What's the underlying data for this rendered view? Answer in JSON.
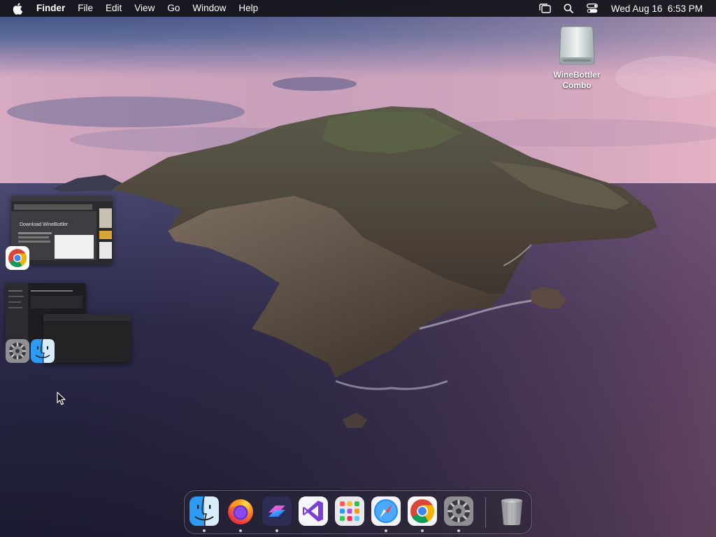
{
  "menubar": {
    "apple_icon": "apple-logo-icon",
    "app_name": "Finder",
    "menus": [
      "File",
      "Edit",
      "View",
      "Go",
      "Window"
    ],
    "help": "Help",
    "status_icons": [
      "stage-manager-icon",
      "spotlight-search-icon",
      "control-center-icon"
    ],
    "clock": "Wed Aug 16  6:53 PM"
  },
  "desktop": {
    "items": [
      {
        "label": "WineBottler Combo",
        "icon": "external-drive-icon"
      }
    ]
  },
  "stage_manager": {
    "groups": [
      {
        "app": "Google Chrome",
        "icon": "chrome-icon",
        "thumbnail_text": "Download WineBottler"
      },
      {
        "apps": [
          "System Settings",
          "Finder"
        ],
        "icons": [
          "system-settings-icon",
          "finder-icon"
        ]
      }
    ]
  },
  "dock": {
    "apps": [
      {
        "name": "Finder",
        "icon": "finder-icon",
        "running": true
      },
      {
        "name": "Firefox",
        "icon": "firefox-icon",
        "running": true
      },
      {
        "name": "Shortcuts",
        "icon": "shortcuts-icon",
        "running": true
      },
      {
        "name": "Visual Studio",
        "icon": "visual-studio-icon",
        "running": false
      },
      {
        "name": "Launchpad",
        "icon": "launchpad-icon",
        "running": false
      },
      {
        "name": "Safari",
        "icon": "safari-icon",
        "running": true
      },
      {
        "name": "Google Chrome",
        "icon": "chrome-icon",
        "running": true
      },
      {
        "name": "System Settings",
        "icon": "system-settings-icon",
        "running": true
      }
    ],
    "trash": {
      "name": "Trash",
      "icon": "trash-icon"
    }
  },
  "colors": {
    "menubar_bg": "#141218",
    "sky_top": "#3a4a78",
    "sky_horizon": "#d8a8c0",
    "sea": "#2a2a48"
  }
}
